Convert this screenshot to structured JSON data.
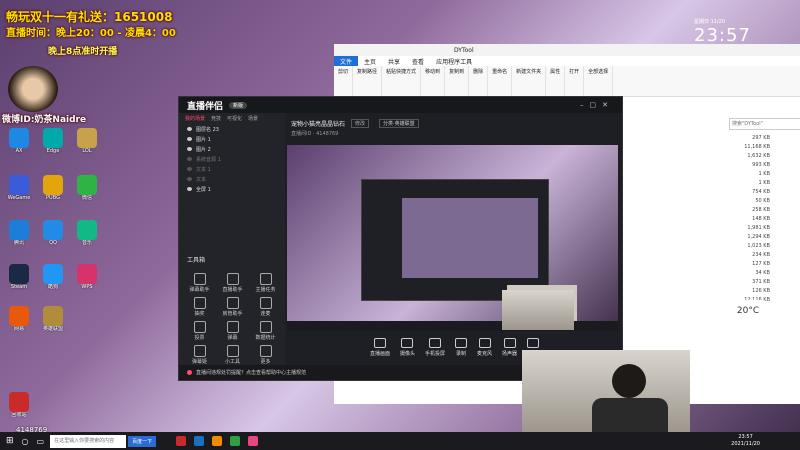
{
  "overlay": {
    "line1": "畅玩双十一有礼送：1651008",
    "line2": "直播时间：晚上20：00 - 凌晨4：00",
    "line3": "晚上8点准时开播",
    "weibo": "微博ID:奶茶Naidre",
    "counter": "4148769"
  },
  "clock": {
    "date": "星期日 11/20",
    "time": "23:57"
  },
  "desktop_icons": [
    {
      "label": "AX"
    },
    {
      "label": "Edge"
    },
    {
      "label": "LOL"
    },
    {
      "label": "WeGame"
    },
    {
      "label": "PUBG"
    },
    {
      "label": "微信"
    },
    {
      "label": "腾讯"
    },
    {
      "label": "QQ"
    },
    {
      "label": "音乐"
    },
    {
      "label": "Steam"
    },
    {
      "label": "酷狗"
    },
    {
      "label": "WPS"
    },
    {
      "label": "网易"
    },
    {
      "label": "英雄联盟"
    },
    {
      "label": "回收站"
    }
  ],
  "explorer": {
    "title": "DYTool",
    "tabs": [
      "文件",
      "主页",
      "共享",
      "查看",
      "应用程序工具"
    ],
    "groups": [
      "剪切",
      "复制路径",
      "粘贴快捷方式",
      "移动到",
      "复制到",
      "删除",
      "重命名",
      "新建文件夹",
      "属性",
      "打开",
      "全部选择"
    ],
    "search_placeholder": "搜索\"DYTool\"",
    "sizes": [
      "297 KB",
      "11,168 KB",
      "1,632 KB",
      "993 KB",
      "1 KB",
      "1 KB",
      "754 KB",
      "50 KB",
      "258 KB",
      "148 KB",
      "1,981 KB",
      "1,294 KB",
      "1,023 KB",
      "234 KB",
      "127 KB",
      "34 KB",
      "371 KB",
      "126 KB",
      "12,116 KB",
      "11,168 KB"
    ]
  },
  "app": {
    "logo": "直播伴侣",
    "version": "新版",
    "tabs": [
      "我的场景",
      "竞技",
      "可视化",
      "场景"
    ],
    "scenes": [
      {
        "label": "图层名 23",
        "dim": false
      },
      {
        "label": "图片 1",
        "dim": false
      },
      {
        "label": "图片 2",
        "dim": false
      },
      {
        "label": "系统音源 1",
        "dim": true
      },
      {
        "label": "文本 1",
        "dim": true
      },
      {
        "label": "文本",
        "dim": true
      },
      {
        "label": "全屏 1",
        "dim": false
      }
    ],
    "toolbox_title": "工具箱",
    "tools": [
      "弹幕助手",
      "直播助手",
      "主播任务",
      "抽奖",
      "房管助手",
      "连麦",
      "投票",
      "弹幕",
      "数据统计",
      "弹幕姬",
      "小工具",
      "更多"
    ],
    "room_title": "宠物小猫亮晶晶钻石",
    "edit_label": "修改",
    "category": "分类·英雄联盟",
    "room_meta": "直播间ID · 4148769",
    "bottom_actions": [
      "直播画面",
      "摄像头",
      "手机投屏",
      "录制",
      "麦克风",
      "扬声器",
      "设置"
    ],
    "start_label": "开始直播",
    "notice": "直播间违规处罚提醒？点击查看帮助中心主播规范"
  },
  "weather": {
    "temp": "20°C"
  },
  "taskbar": {
    "search_placeholder": "在这里输入你要搜索的内容",
    "search_button": "百度一下",
    "time": "23:57",
    "date": "2021/11/20"
  },
  "colors": {
    "accent": "#ff4d6d",
    "overlay_yellow": "#ffe000",
    "taskbar": "#1b1b1f"
  }
}
